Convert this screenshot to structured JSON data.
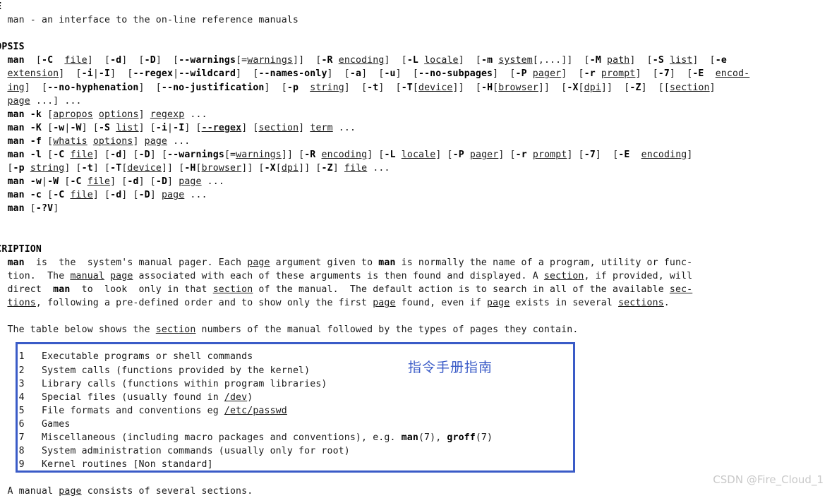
{
  "document": {
    "kind": "man-page",
    "program": "man"
  },
  "sections": {
    "name": {
      "heading": "NAME",
      "body": [
        "     man - an interface to the on-line reference manuals"
      ]
    },
    "synopsis": {
      "heading": "SYNOPSIS",
      "lines": [
        "     man  [-C  file]  [-d]  [-D]  [--warnings[=warnings]]  [-R encoding]  [-L locale]  [-m system[,...]]  [-M path]  [-S list]  [-e",
        "     extension]  [-i|-I]  [--regex|--wildcard]  [--names-only]  [-a]  [-u]  [--no-subpages]  [-P pager]  [-r prompt]  [-7]  [-E  encod-",
        "     ing]  [--no-hyphenation]  [--no-justification]  [-p  string]  [-t]  [-T[device]]  [-H[browser]]  [-X[dpi]]  [-Z]  [[section]",
        "     page ...] ...",
        "     man -k [apropos options] regexp ...",
        "     man -K [-w|-W] [-S list] [-i|-I] [--regex] [section] term ...",
        "     man -f [whatis options] page ...",
        "     man -l [-C file] [-d] [-D] [--warnings[=warnings]] [-R encoding] [-L locale] [-P pager] [-r prompt] [-7]  [-E  encoding]",
        "     [-p string] [-t] [-T[device]] [-H[browser]] [-X[dpi]] [-Z] file ...",
        "     man -w|-W [-C file] [-d] [-D] page ...",
        "     man -c [-C file] [-d] [-D] page ...",
        "     man [-?V]"
      ]
    },
    "description": {
      "heading": "DESCRIPTION",
      "paragraph1": [
        "     man  is  the  system's manual pager. Each page argument given to man is normally the name of a program, utility or func-",
        "     tion.  The manual page associated with each of these arguments is then found and displayed. A section, if provided, will",
        "     direct  man  to  look  only in that section of the manual.  The default action is to search in all of the available sec-",
        "     tions, following a pre-defined order and to show only the first page found, even if page exists in several sections."
      ],
      "paragraph2": "     The table below shows the section numbers of the manual followed by the types of pages they contain.",
      "closing": "     A manual page consists of several sections."
    }
  },
  "section_table": {
    "rows": [
      {
        "number": "1",
        "description": "Executable programs or shell commands"
      },
      {
        "number": "2",
        "description": "System calls (functions provided by the kernel)"
      },
      {
        "number": "3",
        "description": "Library calls (functions within program libraries)"
      },
      {
        "number": "4",
        "description": "Special files (usually found in /dev)"
      },
      {
        "number": "5",
        "description": "File formats and conventions eg /etc/passwd"
      },
      {
        "number": "6",
        "description": "Games"
      },
      {
        "number": "7",
        "description": "Miscellaneous (including macro packages and conventions), e.g. man(7), groff(7)"
      },
      {
        "number": "8",
        "description": "System administration commands (usually only for root)"
      },
      {
        "number": "9",
        "description": "Kernel routines [Non standard]"
      }
    ]
  },
  "annotations": {
    "chinese_note": "指令手册指南",
    "box_color": "#3a5bc7"
  },
  "watermark": {
    "text": "CSDN @Fire_Cloud_1",
    "color": "#c9c9c9"
  }
}
